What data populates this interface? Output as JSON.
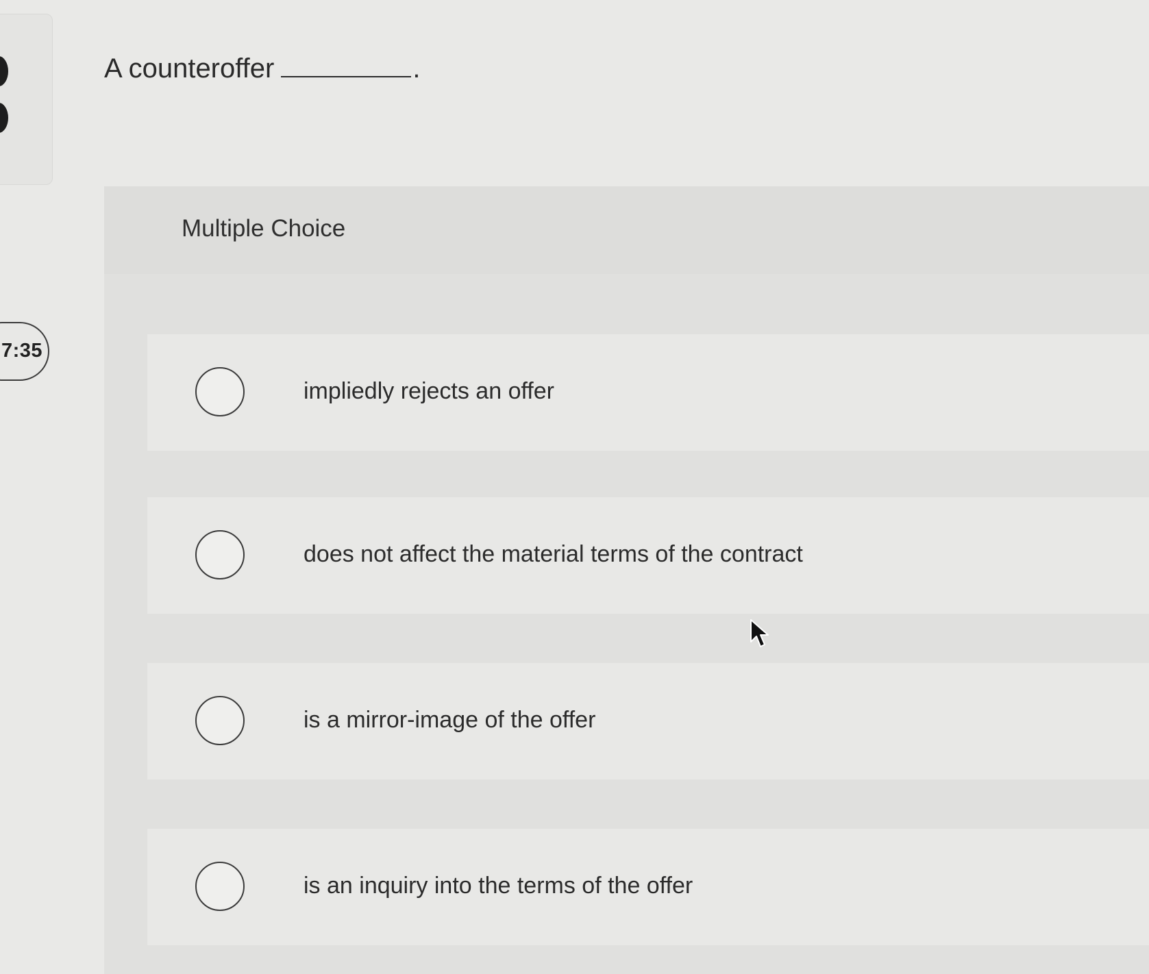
{
  "question": {
    "text": "A counteroffer",
    "end_punctuation": "."
  },
  "timer": {
    "label": "7:35"
  },
  "multiple_choice": {
    "title": "Multiple Choice",
    "options": [
      {
        "label": "impliedly rejects an offer",
        "selected": false
      },
      {
        "label": "does not affect the material terms of the contract",
        "selected": false
      },
      {
        "label": "is a mirror-image of the offer",
        "selected": false
      },
      {
        "label": "is an inquiry into the terms of the offer",
        "selected": false
      }
    ]
  }
}
